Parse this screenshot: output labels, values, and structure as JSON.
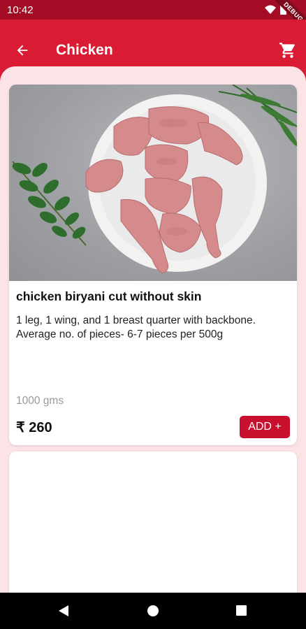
{
  "status_bar": {
    "time": "10:42",
    "debug_label": "DEBUG"
  },
  "app_bar": {
    "title": "Chicken",
    "back_icon": "arrow-back-icon",
    "cart_icon": "shopping-cart-icon"
  },
  "products": [
    {
      "name": "chicken biryani cut without skin",
      "description": " 1 leg, 1 wing, and 1 breast quarter with backbone. Average no. of pieces- 6-7 pieces per 500g",
      "weight": "1000 gms",
      "price": "₹ 260",
      "add_label": "ADD +"
    }
  ],
  "colors": {
    "primary": "#d91c34",
    "status_bar": "#a40c25",
    "background": "#fbe3e6",
    "button": "#c8102e"
  }
}
